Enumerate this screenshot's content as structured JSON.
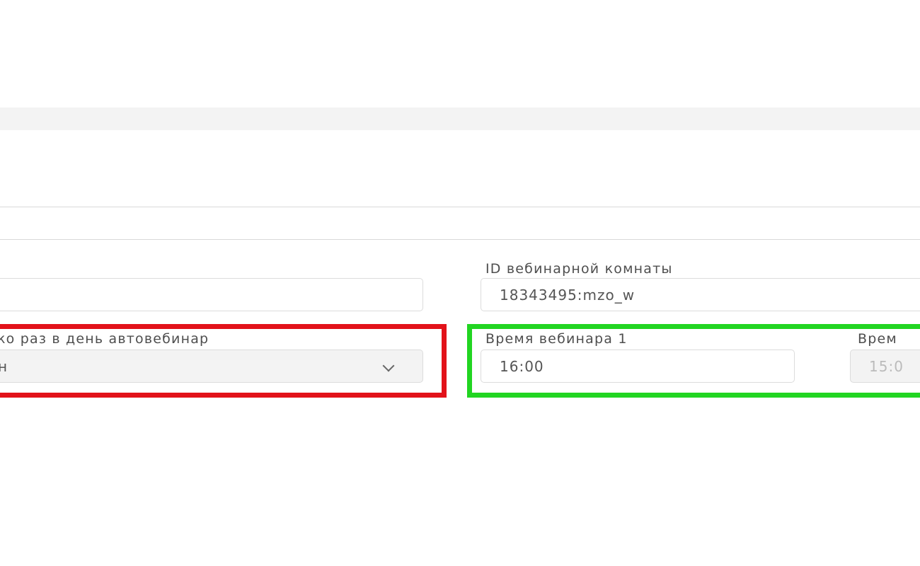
{
  "form": {
    "room_id": {
      "label": "ID вебинарной комнаты",
      "value": "18343495:mzo_w"
    },
    "times_per_day": {
      "label": "ко раз в день автовебинар",
      "selected": "н"
    },
    "webinar_time_1": {
      "label": "Время вебинара 1",
      "value": "16:00"
    },
    "webinar_time_2": {
      "label": "Врем",
      "value": "15:0"
    }
  },
  "highlights": {
    "red": "#e2121a",
    "green": "#22d522"
  },
  "icons": {
    "select_arrow": "chevron-down-icon"
  }
}
